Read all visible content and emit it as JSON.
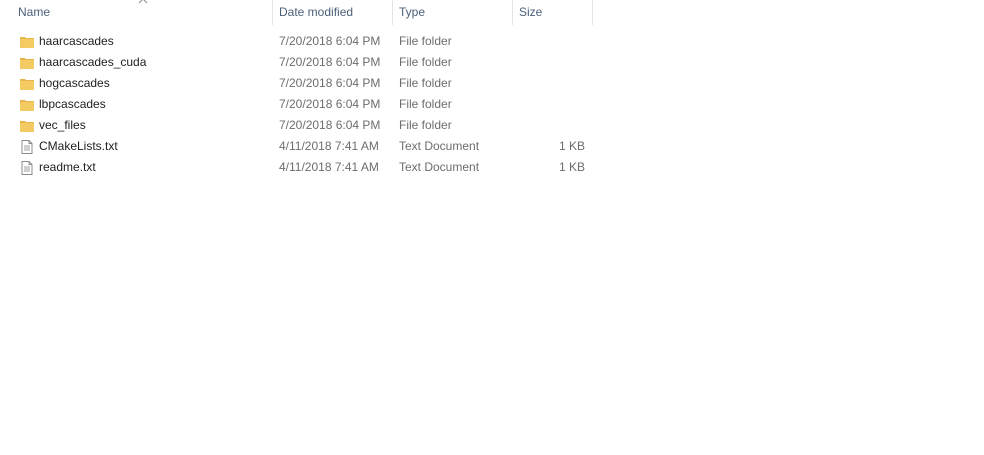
{
  "columns": {
    "name": "Name",
    "date_modified": "Date modified",
    "type": "Type",
    "size": "Size"
  },
  "sort_indicator": "chevron-up-icon",
  "colors": {
    "header_text": "#4c607a",
    "folder_icon": "#f4cb62",
    "detail_text": "#6d6d6d"
  },
  "files": [
    {
      "name": "haarcascades",
      "date_modified": "7/20/2018 6:04 PM",
      "type": "File folder",
      "size": "",
      "icon": "folder-icon"
    },
    {
      "name": "haarcascades_cuda",
      "date_modified": "7/20/2018 6:04 PM",
      "type": "File folder",
      "size": "",
      "icon": "folder-icon"
    },
    {
      "name": "hogcascades",
      "date_modified": "7/20/2018 6:04 PM",
      "type": "File folder",
      "size": "",
      "icon": "folder-icon"
    },
    {
      "name": "lbpcascades",
      "date_modified": "7/20/2018 6:04 PM",
      "type": "File folder",
      "size": "",
      "icon": "folder-icon"
    },
    {
      "name": "vec_files",
      "date_modified": "7/20/2018 6:04 PM",
      "type": "File folder",
      "size": "",
      "icon": "folder-icon"
    },
    {
      "name": "CMakeLists.txt",
      "date_modified": "4/11/2018 7:41 AM",
      "type": "Text Document",
      "size": "1 KB",
      "icon": "text-document-icon"
    },
    {
      "name": "readme.txt",
      "date_modified": "4/11/2018 7:41 AM",
      "type": "Text Document",
      "size": "1 KB",
      "icon": "text-document-icon"
    }
  ]
}
